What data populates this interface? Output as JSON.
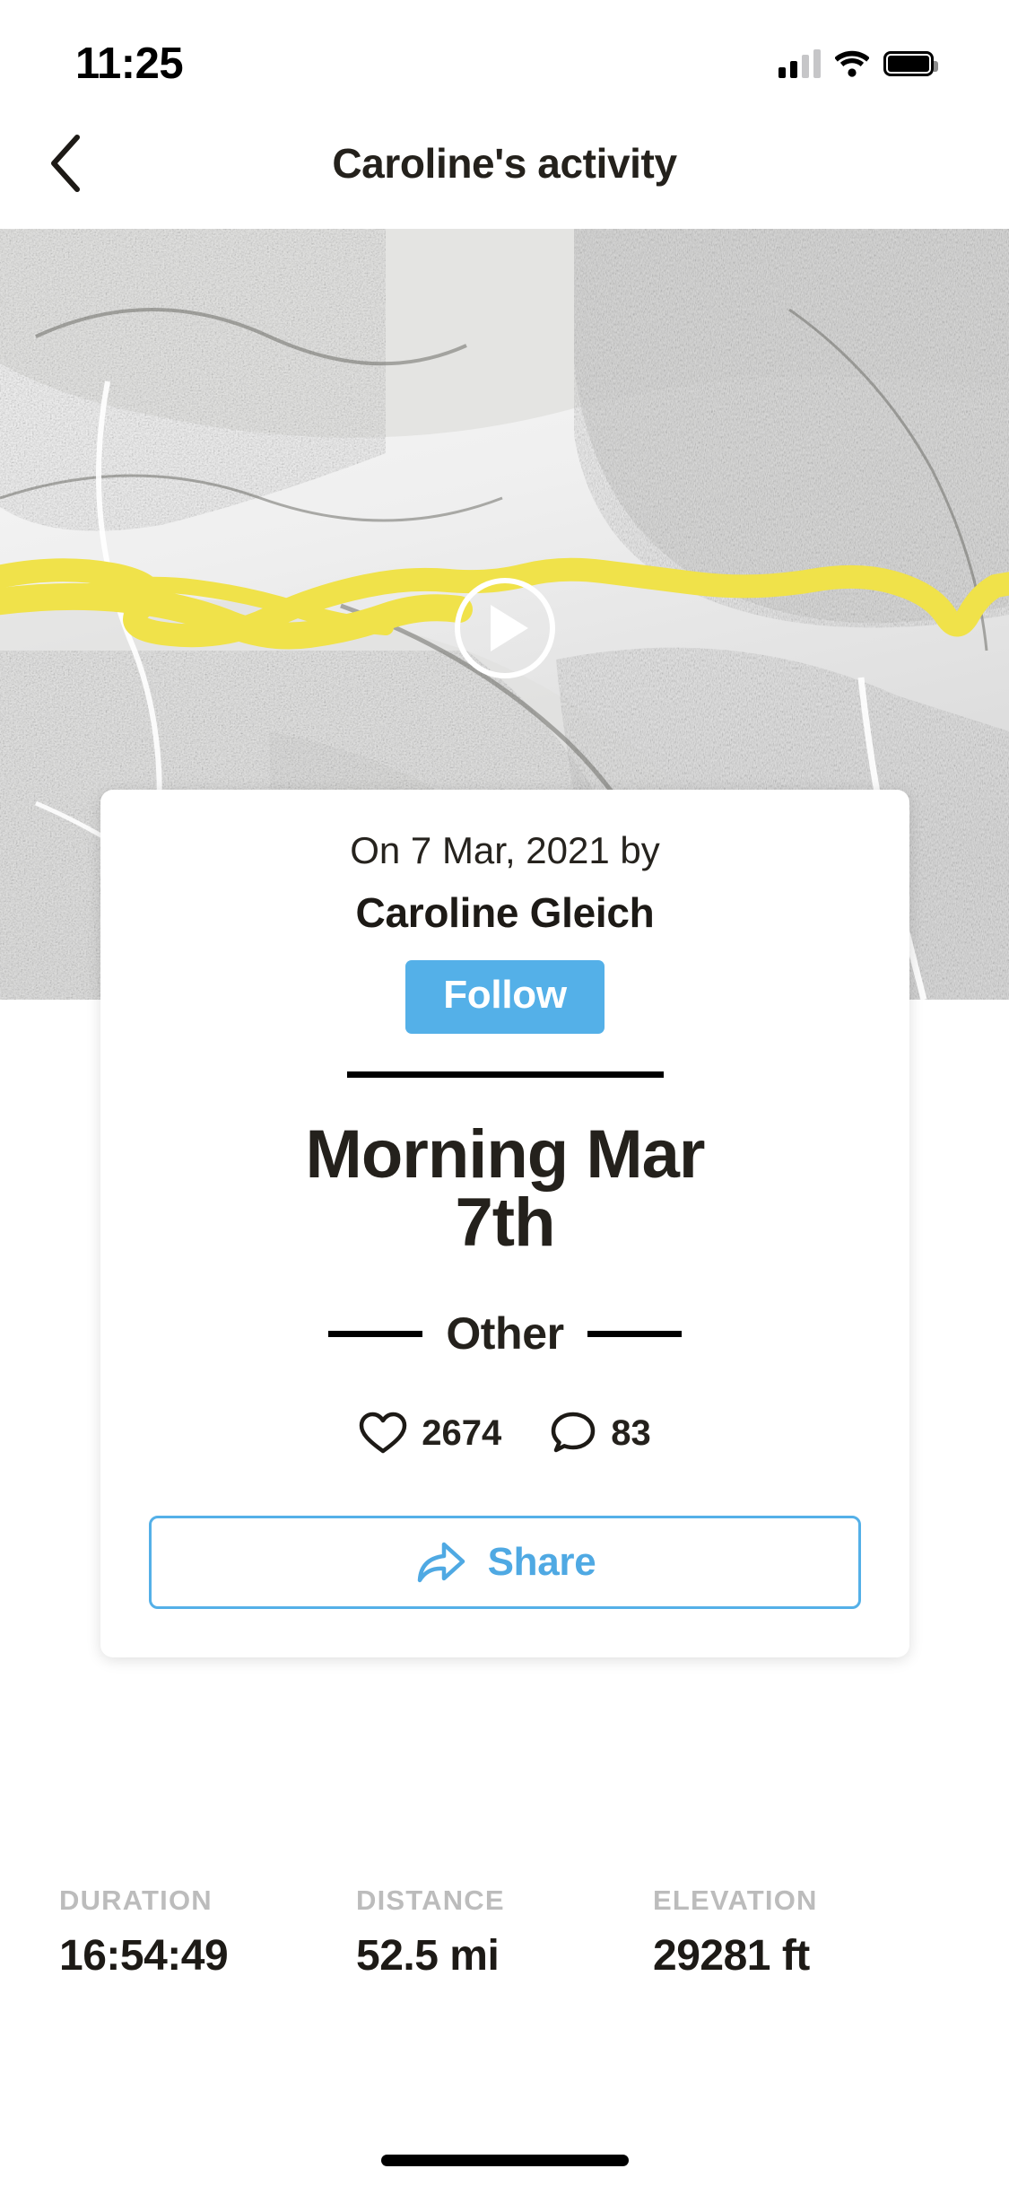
{
  "status_bar": {
    "time": "11:25",
    "cellular_icon": "signal-bars-icon",
    "wifi_icon": "wifi-icon",
    "battery_icon": "battery-full-icon"
  },
  "nav": {
    "back_icon": "chevron-left-icon",
    "title": "Caroline's activity"
  },
  "map": {
    "play_icon": "play-icon",
    "route_color": "#f0e24a",
    "style": "grayscale-satellite"
  },
  "card": {
    "posted_on": "On 7 Mar, 2021 by",
    "author": "Caroline Gleich",
    "follow_label": "Follow",
    "activity_title": "Morning Mar 7th",
    "activity_type": "Other",
    "likes": {
      "icon": "heart-icon",
      "count": "2674"
    },
    "comments": {
      "icon": "comment-icon",
      "count": "83"
    },
    "share": {
      "icon": "share-arrow-icon",
      "label": "Share"
    }
  },
  "stats": [
    {
      "label": "DURATION",
      "value": "16:54:49"
    },
    {
      "label": "DISTANCE",
      "value": "52.5 mi"
    },
    {
      "label": "ELEVATION",
      "value": "29281 ft"
    }
  ],
  "colors": {
    "accent_blue": "#54b0e8",
    "text_dark": "#24211c",
    "label_gray": "#bcbcbc",
    "route_yellow": "#f0e24a"
  }
}
